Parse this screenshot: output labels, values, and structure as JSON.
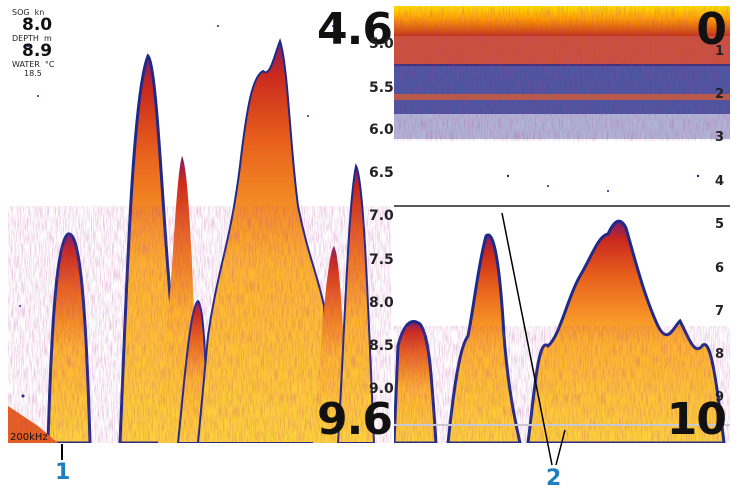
{
  "left_panel": {
    "range_top": "4.6",
    "range_bottom": "9.6",
    "frequency": "200kHz",
    "readouts": [
      {
        "label": "SOG",
        "unit": "kn",
        "value": "8.0"
      },
      {
        "label": "DEPTH",
        "unit": "m",
        "value": "8.9"
      },
      {
        "label": "WATER",
        "unit": "°C",
        "value": "",
        "sub": "18.5"
      }
    ],
    "depth_scale": [
      "5.0",
      "5.5",
      "6.0",
      "6.5",
      "7.0",
      "7.5",
      "8.0",
      "8.5",
      "9.0"
    ]
  },
  "right_panel": {
    "range_top": "0",
    "range_bottom": "10",
    "depth_scale": [
      "1",
      "2",
      "3",
      "4",
      "5",
      "6",
      "7",
      "8",
      "9"
    ]
  },
  "callouts": [
    "1",
    "2"
  ],
  "colors": {
    "sonar_strong": "#ffd43a",
    "sonar_mid": "#e8601c",
    "sonar_weak": "#7a1d6e",
    "noise": "#1d2a8a",
    "callout": "#1e7fc0"
  }
}
